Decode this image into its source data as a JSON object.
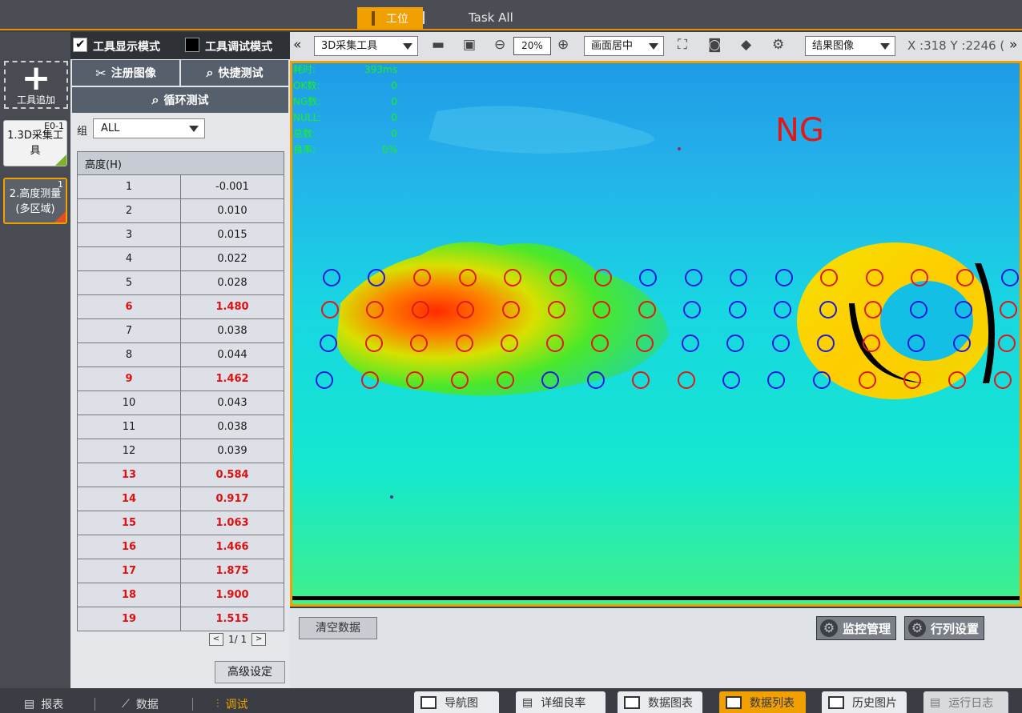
{
  "top": {
    "station_tab": "工位",
    "task_all_tab": "Task All"
  },
  "sidebar": {
    "add_tool_label": "工具追加",
    "tools": [
      {
        "badge": "E0-1",
        "label": "1.3D采集工具"
      },
      {
        "badge": "1",
        "label": "2.高度测量(多区域)"
      }
    ]
  },
  "mode": {
    "display_mode": "工具显示模式",
    "debug_mode": "工具调试模式",
    "display_checked": true,
    "debug_checked": false
  },
  "buttons": {
    "register_image": "注册图像",
    "quick_test": "快捷测试",
    "loop_test": "循环测试",
    "advanced": "高级设定",
    "clear_data": "清空数据",
    "monitor": "监控管理",
    "row_col": "行列设置"
  },
  "group": {
    "label": "组",
    "selected": "ALL"
  },
  "table": {
    "header": "高度(H)",
    "rows": [
      {
        "index": "1",
        "value": "-0.001",
        "ng": false
      },
      {
        "index": "2",
        "value": "0.010",
        "ng": false
      },
      {
        "index": "3",
        "value": "0.015",
        "ng": false
      },
      {
        "index": "4",
        "value": "0.022",
        "ng": false
      },
      {
        "index": "5",
        "value": "0.028",
        "ng": false
      },
      {
        "index": "6",
        "value": "1.480",
        "ng": true
      },
      {
        "index": "7",
        "value": "0.038",
        "ng": false
      },
      {
        "index": "8",
        "value": "0.044",
        "ng": false
      },
      {
        "index": "9",
        "value": "1.462",
        "ng": true
      },
      {
        "index": "10",
        "value": "0.043",
        "ng": false
      },
      {
        "index": "11",
        "value": "0.038",
        "ng": false
      },
      {
        "index": "12",
        "value": "0.039",
        "ng": false
      },
      {
        "index": "13",
        "value": "0.584",
        "ng": true
      },
      {
        "index": "14",
        "value": "0.917",
        "ng": true
      },
      {
        "index": "15",
        "value": "1.063",
        "ng": true
      },
      {
        "index": "16",
        "value": "1.466",
        "ng": true
      },
      {
        "index": "17",
        "value": "1.875",
        "ng": true
      },
      {
        "index": "18",
        "value": "1.900",
        "ng": true
      },
      {
        "index": "19",
        "value": "1.515",
        "ng": true
      }
    ],
    "pager": {
      "prev": "<",
      "text": "1/ 1",
      "next": ">"
    }
  },
  "toolbar": {
    "tool_select": "3D采集工具",
    "zoom": "20%",
    "view_select": "画面居中",
    "result_select": "结果图像",
    "coords": "X :318 Y :2246 (",
    "icons": [
      "folder-icon",
      "save-icon",
      "zoom-out-icon",
      "zoom-in-icon",
      "fit-screen-icon",
      "camera-icon",
      "cube-icon",
      "cube-settings-icon"
    ]
  },
  "image": {
    "stats": [
      {
        "label": "耗时:",
        "value": "393ms"
      },
      {
        "label": "OK数:",
        "value": "0"
      },
      {
        "label": "NG数:",
        "value": "0"
      },
      {
        "label": "NULL:",
        "value": "0"
      },
      {
        "label": "总数:",
        "value": "0"
      },
      {
        "label": "良率:",
        "value": "0%"
      }
    ],
    "result": "NG",
    "colors": {
      "ok_circle": "#1a1ae0",
      "ng_circle": "#e01818",
      "ng_text": "#e01818"
    }
  },
  "bottom_nav": {
    "report": "报表",
    "data": "数据",
    "debug": "调试"
  },
  "view_tabs": [
    "导航图",
    "详细良率",
    "数据图表",
    "数据列表",
    "历史图片",
    "运行日志"
  ],
  "view_tabs_active": "数据列表"
}
